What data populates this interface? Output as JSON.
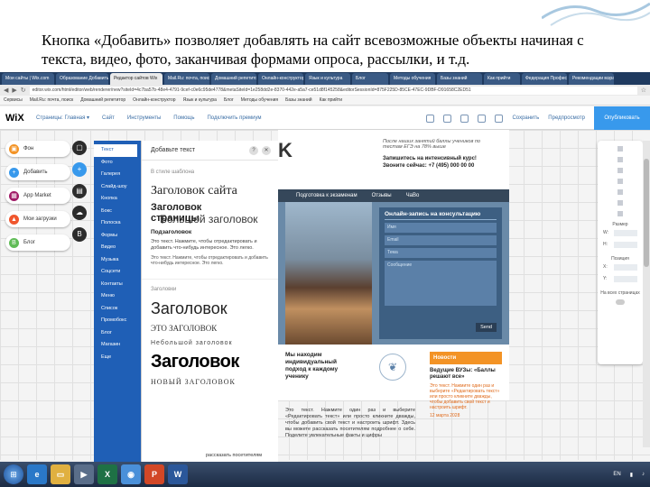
{
  "caption": "Кнопка «Добавить» позволяет добавлять на сайт всевозможные объекты начиная с текста, видео, фото, заканчивая формами опроса, рассылки, и т.д.",
  "browser": {
    "tabs": [
      "Мои сайты | Wix.com",
      "Образование Добавить",
      "Редактор сайтов Wix",
      "Mail.Ru: почта, поиск",
      "Домашний репетитор",
      "Онлайн-конструктор",
      "Язык и культура",
      "Блог",
      "Методы обучения",
      "Базы знаний",
      "Как прийти",
      "Федерация Професси",
      "Рекомендации мэра"
    ],
    "url": "editor.wix.com/html/editor/web/renderer/new?siteId=4c7ba57b-48e4-4791-9cef-c0e6c95de4778&metaSiteId=1e258dd2e-8370-442e-a5a7-ce51d8f145258&editorSessionId=875F225D-85CE-47EC-9DBF-D91658C2ED51",
    "bookmarks": [
      "Сервисы",
      "Mail.Ru: почта, поиск",
      "Домашний репетитор",
      "Онлайн-конструктор",
      "Язык и культура",
      "Блог",
      "Методы обучения",
      "Базы знаний",
      "Как прийти"
    ]
  },
  "wix_toolbar": {
    "logo": "WiX",
    "pages_label": "Страницы: Главная",
    "nav": [
      "Сайт",
      "Инструменты",
      "Помощь",
      "Подключить премиум"
    ],
    "save": "Сохранить",
    "preview": "Предпросмотр",
    "publish": "Опубликовать"
  },
  "left_buttons": [
    {
      "label": "Фон",
      "color": "#f39325",
      "icon": "background-icon"
    },
    {
      "label": "Добавить",
      "color": "#3899ec",
      "icon": "plus-icon"
    },
    {
      "label": "App Market",
      "color": "#a01a66",
      "icon": "apps-icon"
    },
    {
      "label": "Мои загрузки",
      "color": "#f0562e",
      "icon": "upload-icon"
    },
    {
      "label": "Блог",
      "color": "#60bc57",
      "icon": "blog-icon"
    }
  ],
  "add_categories": [
    "Текст",
    "Фото",
    "Галерея",
    "Слайд-шоу",
    "Кнопка",
    "Бокс",
    "Полоска",
    "Формы",
    "Видео",
    "Музыка",
    "Соцсети",
    "Контакты",
    "Меню",
    "Список",
    "Промобокс",
    "Блог",
    "Магазин",
    "Еще"
  ],
  "add_panel": {
    "title": "Добавьте текст",
    "help": "?",
    "close": "✕",
    "template_section": "В стиле шаблона",
    "site_heading": "Заголовок сайта",
    "page_heading": "Заголовок страницы",
    "big_heading": "Большой заголовок",
    "subheading": "Подзаголовок",
    "text1": "Это текст. Нажмите, чтобы отредактировать и добавить что-нибудь интересное. Это легко.",
    "text2": "Это текст. Нажмите, чтобы отредактировать и добавить что-нибудь интересное. Это легко.",
    "headings_section": "Заголовки",
    "h_big": "Заголовок",
    "h_caps": "ЭТО ЗАГОЛОВОК",
    "h_small": "Небольшой заголовок",
    "h_bold": "Заголовок",
    "h_new": "НОВЫЙ ЗАГОЛОВОК"
  },
  "site": {
    "logo_partial": "K",
    "promo": "После наших занятий баллы учеников по тестам ЕГЭ на 78% выше",
    "enroll": "Запишитесь на интенсивный курс!",
    "phone": "Звоните сейчас: +7 (495) 000 00 00",
    "nav": [
      "Подготовка к экзаменам",
      "Отзывы",
      "ЧаВо"
    ],
    "form": {
      "title": "Онлайн-запись на консультацию",
      "fields": [
        "Имя",
        "Email",
        "Тема"
      ],
      "message": "Сообщение",
      "send": "Send"
    },
    "approach": "Мы находим индивидуальный подход к каждому ученику",
    "body": "Это текст. Нажмите один раз и выберите «Редактировать текст» или просто кликните дважды, чтобы добавить свой текст и настроить шрифт. Здесь вы можете рассказать посетителям подробнее о себе. Поделите увлекательные факты и цифры",
    "news_title": "Новости",
    "news_head": "Ведущие ВУЗы: «Баллы решают все»",
    "news_body": "Это текст. Нажмите один раз и выберите «Редактировать текст» или просто кликните дважды, чтобы добавить свой текст и настроить шрифт.",
    "news_date": "12 марта 2028"
  },
  "right_panel": {
    "size": "Размер",
    "w": "W:",
    "h": "H:",
    "position": "Позиция",
    "x": "X:",
    "y": "Y:",
    "on_all_pages": "На всех страницах"
  },
  "bottom_text": "рассказать посетителям",
  "taskbar": {
    "lang": "EN"
  }
}
